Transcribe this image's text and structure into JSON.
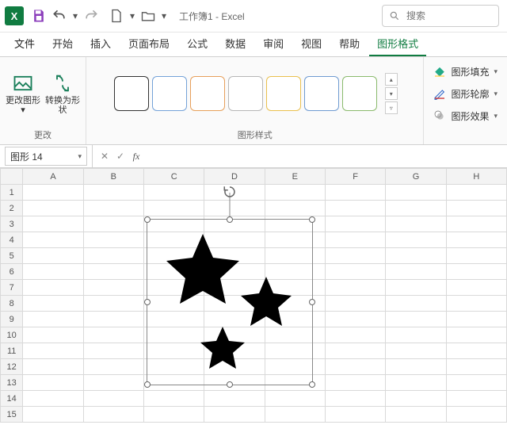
{
  "titlebar": {
    "title": "工作簿1 - Excel",
    "search_placeholder": "搜索"
  },
  "tabs": {
    "file": "文件",
    "home": "开始",
    "insert": "插入",
    "layout": "页面布局",
    "formulas": "公式",
    "data": "数据",
    "review": "审阅",
    "view": "视图",
    "help": "帮助",
    "shapeformat": "图形格式"
  },
  "ribbon": {
    "change_group": "更改",
    "change_shape": "更改图形",
    "convert_shape": "转换为形状",
    "styles_group": "图形样式",
    "fill": "图形填充",
    "outline": "图形轮廓",
    "effects": "图形效果"
  },
  "namebox": "图形 14",
  "formula": "",
  "columns": [
    "A",
    "B",
    "C",
    "D",
    "E",
    "F",
    "G",
    "H"
  ],
  "rows": [
    "1",
    "2",
    "3",
    "4",
    "5",
    "6",
    "7",
    "8",
    "9",
    "10",
    "11",
    "12",
    "13",
    "14",
    "15"
  ],
  "style_colors": [
    "#333",
    "#74a2d8",
    "#e7a05b",
    "#b7b7b7",
    "#e9c04f",
    "#6f9bd1",
    "#8aba6c"
  ]
}
